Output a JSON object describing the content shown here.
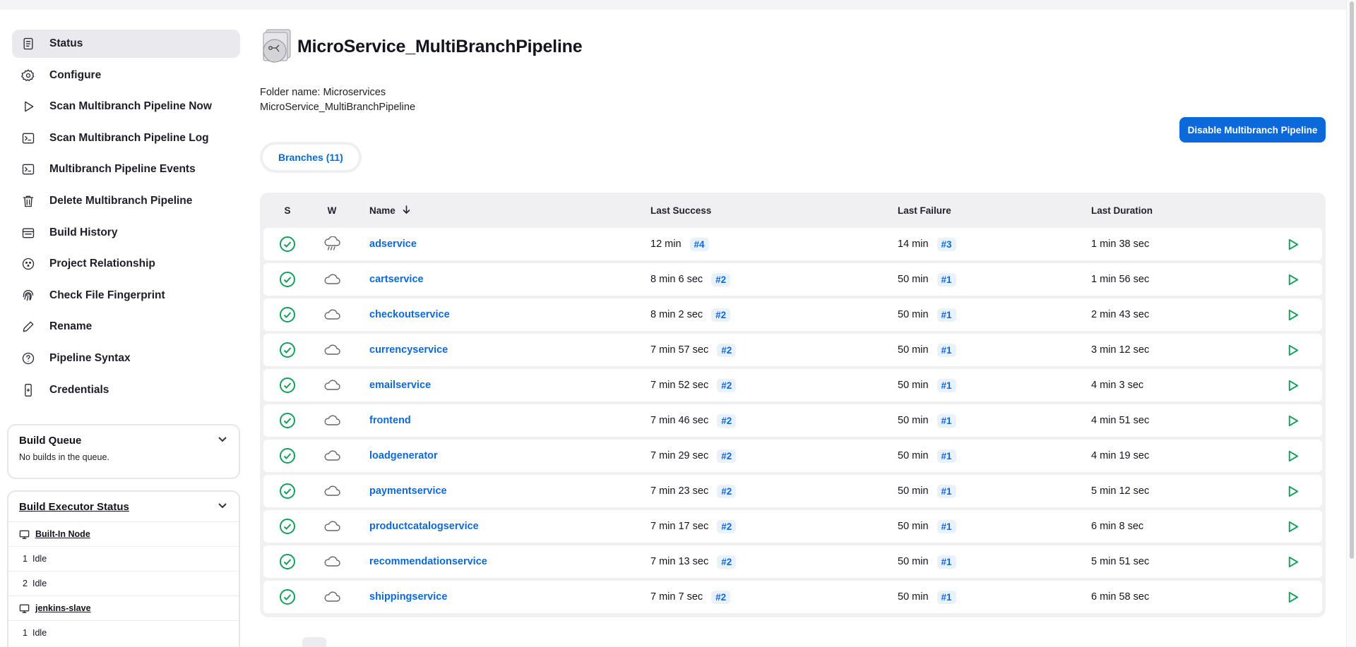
{
  "sidebar": {
    "items": [
      {
        "label": "Status",
        "icon": "status-icon"
      },
      {
        "label": "Configure",
        "icon": "gear-icon"
      },
      {
        "label": "Scan Multibranch Pipeline Now",
        "icon": "play-icon"
      },
      {
        "label": "Scan Multibranch Pipeline Log",
        "icon": "terminal-icon"
      },
      {
        "label": "Multibranch Pipeline Events",
        "icon": "terminal-icon"
      },
      {
        "label": "Delete Multibranch Pipeline",
        "icon": "trash-icon"
      },
      {
        "label": "Build History",
        "icon": "history-icon"
      },
      {
        "label": "Project Relationship",
        "icon": "relationship-icon"
      },
      {
        "label": "Check File Fingerprint",
        "icon": "fingerprint-icon"
      },
      {
        "label": "Rename",
        "icon": "pencil-icon"
      },
      {
        "label": "Pipeline Syntax",
        "icon": "help-icon"
      },
      {
        "label": "Credentials",
        "icon": "credentials-icon"
      }
    ]
  },
  "build_queue": {
    "title": "Build Queue",
    "empty": "No builds in the queue."
  },
  "executors": {
    "title": "Build Executor Status",
    "nodes": [
      {
        "name": "Built-In Node",
        "slots": [
          {
            "num": "1",
            "state": "Idle"
          },
          {
            "num": "2",
            "state": "Idle"
          }
        ]
      },
      {
        "name": "jenkins-slave",
        "slots": [
          {
            "num": "1",
            "state": "Idle"
          }
        ]
      }
    ]
  },
  "page": {
    "title": "MicroService_MultiBranchPipeline",
    "folder_line": "Folder name: Microservices",
    "name_line": "MicroService_MultiBranchPipeline",
    "disable_button": "Disable Multibranch Pipeline",
    "tab": "Branches (11)"
  },
  "table": {
    "headers": {
      "s": "S",
      "w": "W",
      "name": "Name",
      "last_success": "Last Success",
      "last_failure": "Last Failure",
      "last_duration": "Last Duration"
    },
    "rows": [
      {
        "name": "adservice",
        "ls": "12 min",
        "ls_build": "#4",
        "lf": "14 min",
        "lf_build": "#3",
        "ld": "1 min 38 sec",
        "weather": "rain"
      },
      {
        "name": "cartservice",
        "ls": "8 min 6 sec",
        "ls_build": "#2",
        "lf": "50 min",
        "lf_build": "#1",
        "ld": "1 min 56 sec",
        "weather": "cloud"
      },
      {
        "name": "checkoutservice",
        "ls": "8 min 2 sec",
        "ls_build": "#2",
        "lf": "50 min",
        "lf_build": "#1",
        "ld": "2 min 43 sec",
        "weather": "cloud"
      },
      {
        "name": "currencyservice",
        "ls": "7 min 57 sec",
        "ls_build": "#2",
        "lf": "50 min",
        "lf_build": "#1",
        "ld": "3 min 12 sec",
        "weather": "cloud"
      },
      {
        "name": "emailservice",
        "ls": "7 min 52 sec",
        "ls_build": "#2",
        "lf": "50 min",
        "lf_build": "#1",
        "ld": "4 min 3 sec",
        "weather": "cloud"
      },
      {
        "name": "frontend",
        "ls": "7 min 46 sec",
        "ls_build": "#2",
        "lf": "50 min",
        "lf_build": "#1",
        "ld": "4 min 51 sec",
        "weather": "cloud"
      },
      {
        "name": "loadgenerator",
        "ls": "7 min 29 sec",
        "ls_build": "#2",
        "lf": "50 min",
        "lf_build": "#1",
        "ld": "4 min 19 sec",
        "weather": "cloud"
      },
      {
        "name": "paymentservice",
        "ls": "7 min 23 sec",
        "ls_build": "#2",
        "lf": "50 min",
        "lf_build": "#1",
        "ld": "5 min 12 sec",
        "weather": "cloud"
      },
      {
        "name": "productcatalogservice",
        "ls": "7 min 17 sec",
        "ls_build": "#2",
        "lf": "50 min",
        "lf_build": "#1",
        "ld": "6 min 8 sec",
        "weather": "cloud"
      },
      {
        "name": "recommendationservice",
        "ls": "7 min 13 sec",
        "ls_build": "#2",
        "lf": "50 min",
        "lf_build": "#1",
        "ld": "5 min 51 sec",
        "weather": "cloud"
      },
      {
        "name": "shippingservice",
        "ls": "7 min 7 sec",
        "ls_build": "#2",
        "lf": "50 min",
        "lf_build": "#1",
        "ld": "6 min 58 sec",
        "weather": "cloud"
      }
    ]
  },
  "colors": {
    "accent": "#0b69d9",
    "success": "#12a05c"
  }
}
